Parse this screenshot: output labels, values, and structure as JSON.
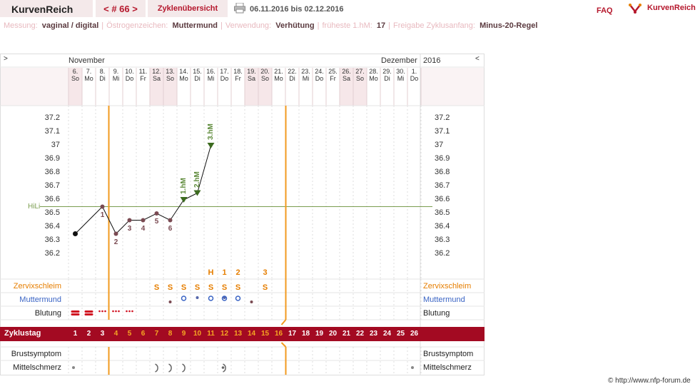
{
  "header": {
    "brand": "KurvenReich",
    "cycle_nav": "< # 66 >",
    "overview_tab": "Zyklenübersicht",
    "date_range": "06.11.2016 bis 02.12.2016",
    "faq": "FAQ",
    "logo_text": "KurvenReich"
  },
  "settings": [
    {
      "label": "Messung:",
      "value": "vaginal / digital"
    },
    {
      "label": "Östrogenzeichen:",
      "value": "Muttermund"
    },
    {
      "label": "Verwendung:",
      "value": "Verhütung"
    },
    {
      "label": "früheste 1.hM:",
      "value": "17"
    },
    {
      "label": "Freigabe Zyklusanfang:",
      "value": "Minus-20-Regel"
    }
  ],
  "chart": {
    "nav_prev": ">",
    "nav_next": "<",
    "month_left": "November",
    "month_right": "Dezember",
    "year": "2016",
    "days": [
      {
        "d": "6.",
        "w": "So",
        "weekend": true
      },
      {
        "d": "7.",
        "w": "Mo",
        "weekend": false
      },
      {
        "d": "8.",
        "w": "Di",
        "weekend": false
      },
      {
        "d": "9.",
        "w": "Mi",
        "weekend": false
      },
      {
        "d": "10.",
        "w": "Do",
        "weekend": false
      },
      {
        "d": "11.",
        "w": "Fr",
        "weekend": false
      },
      {
        "d": "12.",
        "w": "Sa",
        "weekend": true
      },
      {
        "d": "13.",
        "w": "So",
        "weekend": true
      },
      {
        "d": "14.",
        "w": "Mo",
        "weekend": false
      },
      {
        "d": "15.",
        "w": "Di",
        "weekend": false
      },
      {
        "d": "16.",
        "w": "Mi",
        "weekend": false
      },
      {
        "d": "17.",
        "w": "Do",
        "weekend": false
      },
      {
        "d": "18.",
        "w": "Fr",
        "weekend": false
      },
      {
        "d": "19.",
        "w": "Sa",
        "weekend": true
      },
      {
        "d": "20.",
        "w": "So",
        "weekend": true
      },
      {
        "d": "21.",
        "w": "Mo",
        "weekend": false
      },
      {
        "d": "22.",
        "w": "Di",
        "weekend": false
      },
      {
        "d": "23.",
        "w": "Mi",
        "weekend": false
      },
      {
        "d": "24.",
        "w": "Do",
        "weekend": false
      },
      {
        "d": "25.",
        "w": "Fr",
        "weekend": false
      },
      {
        "d": "26.",
        "w": "Sa",
        "weekend": true
      },
      {
        "d": "27.",
        "w": "So",
        "weekend": true
      },
      {
        "d": "28.",
        "w": "Mo",
        "weekend": false
      },
      {
        "d": "29.",
        "w": "Di",
        "weekend": false
      },
      {
        "d": "30.",
        "w": "Mi",
        "weekend": false
      },
      {
        "d": "1.",
        "w": "Do",
        "weekend": false
      }
    ],
    "ticks": [
      "37.2",
      "37.1",
      "37",
      "36.9",
      "36.8",
      "36.7",
      "36.6",
      "36.5",
      "36.4",
      "36.3",
      "36.2"
    ],
    "hili_label": "HiLi",
    "hili_value": 36.55,
    "ymin": 36.1,
    "ymax": 37.3,
    "orange_lines_after_day": [
      3,
      16
    ],
    "temperatures": [
      {
        "day": 6,
        "temp": 36.35,
        "label": ""
      },
      {
        "day": 8,
        "temp": 36.55,
        "label": "1"
      },
      {
        "day": 9,
        "temp": 36.35,
        "label": "2"
      },
      {
        "day": 10,
        "temp": 36.45,
        "label": "3"
      },
      {
        "day": 11,
        "temp": 36.45,
        "label": "4"
      },
      {
        "day": 12,
        "temp": 36.5,
        "label": "5"
      },
      {
        "day": 13,
        "temp": 36.45,
        "label": "6"
      },
      {
        "day": 14,
        "temp": 36.6,
        "label": "1.hM",
        "marker": "triangle"
      },
      {
        "day": 15,
        "temp": 36.65,
        "label": "2.hM",
        "marker": "triangle"
      },
      {
        "day": 16,
        "temp": 37.0,
        "label": "3.hM",
        "marker": "triangle"
      }
    ],
    "rows": {
      "zervixschleim": "Zervixschleim",
      "muttermund": "Muttermund",
      "blutung": "Blutung",
      "zyklustag": "Zyklustag",
      "brustsymptom": "Brustsymptom",
      "mittelschmerz": "Mittelschmerz"
    },
    "zervix_marks": [
      {
        "day": 7,
        "mark": "S",
        "top": ""
      },
      {
        "day": 8,
        "mark": "S",
        "top": ""
      },
      {
        "day": 9,
        "mark": "S",
        "top": ""
      },
      {
        "day": 10,
        "mark": "S",
        "top": ""
      },
      {
        "day": 11,
        "mark": "S",
        "top": "H"
      },
      {
        "day": 12,
        "mark": "S",
        "top": "1"
      },
      {
        "day": 13,
        "mark": "S",
        "top": "2"
      },
      {
        "day": 15,
        "mark": "S",
        "top": "3"
      }
    ],
    "cycle_days": [
      "1",
      "2",
      "3",
      "4",
      "5",
      "6",
      "7",
      "8",
      "9",
      "10",
      "11",
      "12",
      "13",
      "14",
      "15",
      "16",
      "17",
      "18",
      "19",
      "20",
      "21",
      "22",
      "23",
      "24",
      "25",
      "26"
    ]
  },
  "colors": {
    "brand_red": "#b5172c",
    "bar_red": "#a30a22",
    "orange": "#e67e00",
    "green": "#5d8a3a",
    "blue": "#3a64c4",
    "weekend": "#f6e7e9"
  },
  "copyright": "© http://www.nfp-forum.de"
}
